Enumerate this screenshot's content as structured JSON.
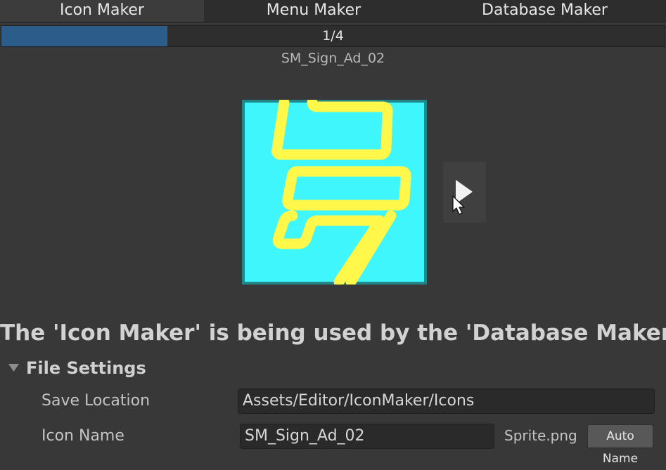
{
  "tabs": [
    {
      "label": "Icon Maker",
      "active": true
    },
    {
      "label": "Menu Maker",
      "active": false
    },
    {
      "label": "Database Maker",
      "active": false
    }
  ],
  "progress": {
    "label": "1/4",
    "fraction": 0.25,
    "fill_color": "#2b5c8a"
  },
  "asset_name": "SM_Sign_Ad_02",
  "preview": {
    "background_color": "#23878a",
    "icon_color": "#3ef6fb",
    "stroke_color": "#fff74a"
  },
  "next_button": {
    "icon": "play-arrow-icon"
  },
  "warning": "The 'Icon Maker' is being used by the 'Database Maker'",
  "file_settings": {
    "title": "File Settings",
    "expanded": true,
    "save_location": {
      "label": "Save Location",
      "value": "Assets/Editor/IconMaker/Icons"
    },
    "icon_name": {
      "label": "Icon Name",
      "value": "SM_Sign_Ad_02",
      "suffix": "Sprite.png",
      "button": "Auto Name"
    }
  }
}
